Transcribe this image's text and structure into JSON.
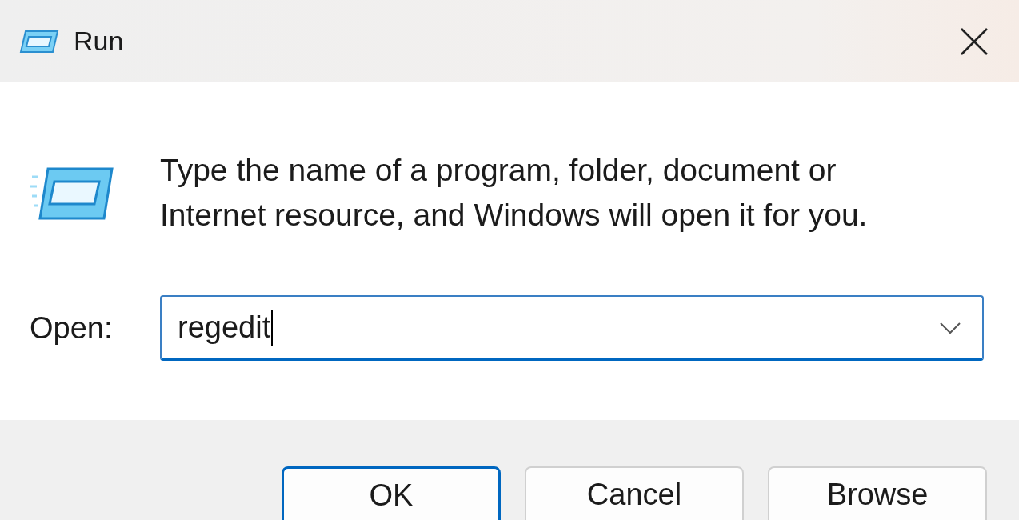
{
  "window": {
    "title": "Run"
  },
  "message": "Type the name of a program, folder, document or Internet resource, and Windows will open it for you.",
  "open_field": {
    "label": "Open:",
    "value": "regedit",
    "focused": true
  },
  "buttons": [
    {
      "label": "OK",
      "default": true
    },
    {
      "label": "Cancel",
      "default": false
    },
    {
      "label": "Browse",
      "default": false
    }
  ]
}
